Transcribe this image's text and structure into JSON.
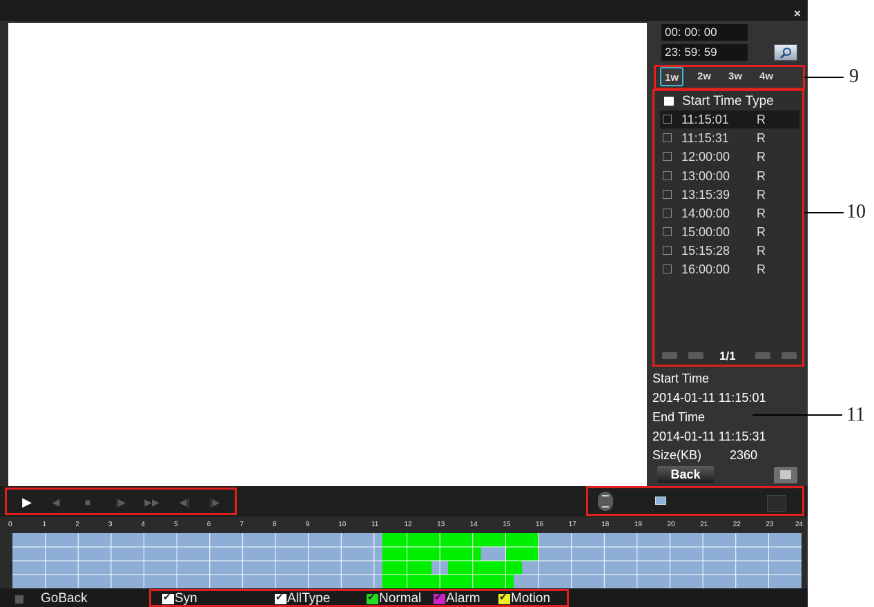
{
  "time_range": {
    "start": "00: 00: 00",
    "end": "23: 59: 59"
  },
  "week_tabs": [
    "1w",
    "2w",
    "3w",
    "4w"
  ],
  "week_selected": "1w",
  "file_list": {
    "header": "Start Time Type",
    "rows": [
      {
        "time": "11:15:01",
        "type": "R"
      },
      {
        "time": "11:15:31",
        "type": "R"
      },
      {
        "time": "12:00:00",
        "type": "R"
      },
      {
        "time": "13:00:00",
        "type": "R"
      },
      {
        "time": "13:15:39",
        "type": "R"
      },
      {
        "time": "14:00:00",
        "type": "R"
      },
      {
        "time": "15:00:00",
        "type": "R"
      },
      {
        "time": "15:15:28",
        "type": "R"
      },
      {
        "time": "16:00:00",
        "type": "R"
      }
    ],
    "page": "1/1"
  },
  "file_info": {
    "start_label": "Start Time",
    "start_value": "2014-01-11 11:15:01",
    "end_label": "End Time",
    "end_value": "2014-01-11 11:15:31",
    "size_label": "Size(KB)",
    "size_value": "2360",
    "back_label": "Back"
  },
  "playback_controls": [
    "play-icon",
    "reverse-icon",
    "stop-icon",
    "slow-icon",
    "fast-forward-icon",
    "prev-frame-icon",
    "next-frame-icon"
  ],
  "timeline": {
    "hours": [
      "0",
      "1",
      "2",
      "3",
      "4",
      "5",
      "6",
      "7",
      "8",
      "9",
      "10",
      "11",
      "12",
      "13",
      "14",
      "15",
      "16",
      "17",
      "18",
      "19",
      "20",
      "21",
      "22",
      "23",
      "24"
    ],
    "channels": 4,
    "recording_blocks": [
      {
        "channel": 1,
        "start": 11.25,
        "end": 16.0
      },
      {
        "channel": 2,
        "start": 11.25,
        "end": 14.25
      },
      {
        "channel": 2,
        "start": 15.0,
        "end": 16.0
      },
      {
        "channel": 3,
        "start": 11.25,
        "end": 12.75
      },
      {
        "channel": 3,
        "start": 13.25,
        "end": 15.5
      },
      {
        "channel": 4,
        "start": 11.25,
        "end": 15.25
      }
    ],
    "colors": {
      "empty": "#8eaed6",
      "normal": "#00ee00",
      "grid": "#ffffff"
    }
  },
  "bottom": {
    "goback_label": "GoBack",
    "syn_label": "Syn",
    "alltype_label": "AllType",
    "normal_label": "Normal",
    "alarm_label": "Alarm",
    "motion_label": "Motion"
  },
  "legend_colors": {
    "normal": "#22dd22",
    "alarm": "#cc22cc",
    "motion": "#eeee22"
  },
  "callouts": [
    "9",
    "10",
    "11"
  ]
}
